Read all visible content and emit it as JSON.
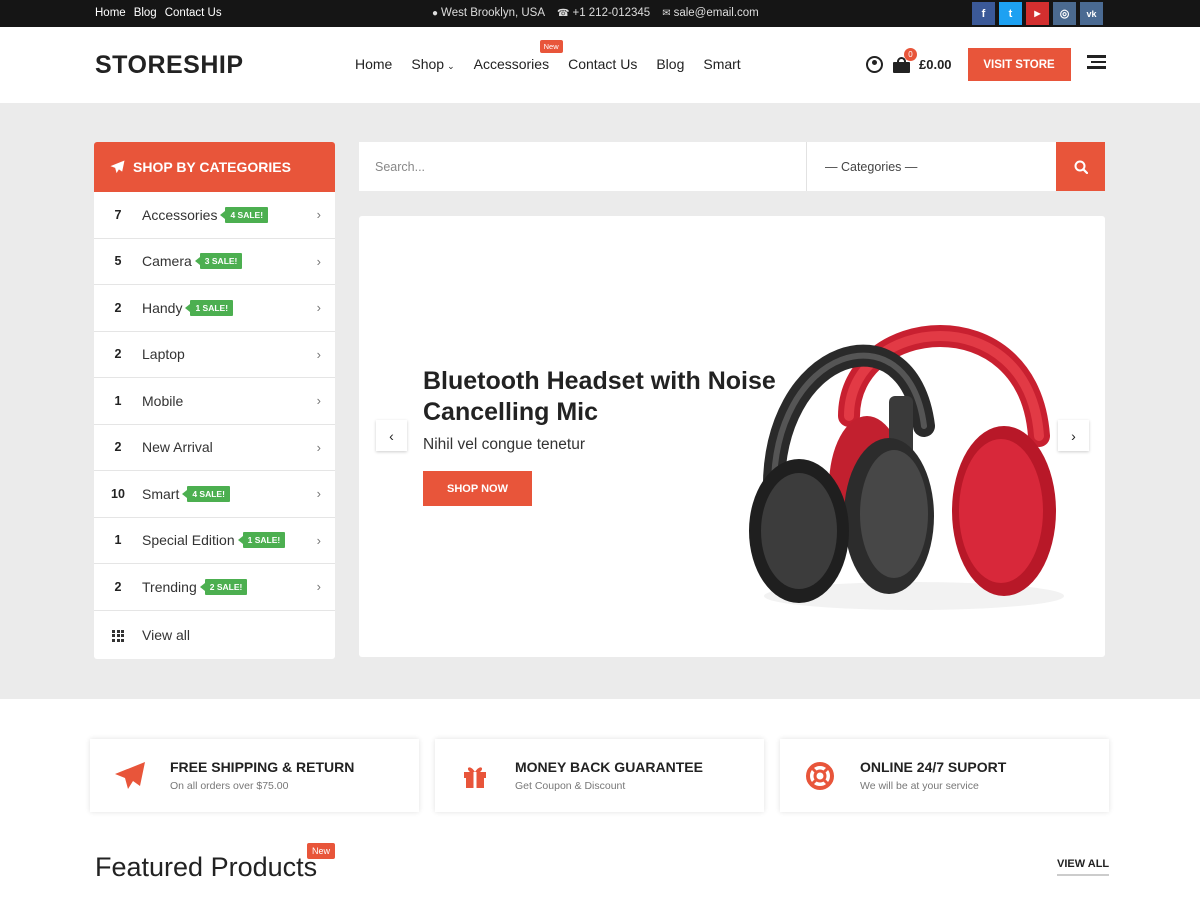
{
  "topbar": {
    "links": [
      "Home",
      "Blog",
      "Contact Us"
    ],
    "location": "West Brooklyn, USA",
    "phone": "+1 212-012345",
    "email": "sale@email.com",
    "socials": [
      {
        "icon": "facebook-icon",
        "glyph": "f",
        "color": "#3b5998"
      },
      {
        "icon": "twitter-icon",
        "glyph": "t",
        "color": "#1da1f2"
      },
      {
        "icon": "youtube-icon",
        "glyph": "▶",
        "color": "#d32f2f"
      },
      {
        "icon": "instagram-icon",
        "glyph": "◎",
        "color": "#4b6a8f"
      },
      {
        "icon": "vk-icon",
        "glyph": "vk",
        "color": "#4a6a92"
      }
    ]
  },
  "header": {
    "logo": "STORESHIP",
    "nav": {
      "home": "Home",
      "shop": "Shop",
      "accessories": "Accessories",
      "accessories_badge": "New",
      "contact": "Contact Us",
      "blog": "Blog",
      "smart": "Smart"
    },
    "cart_count": "0",
    "cart_total": "£0.00",
    "visit_store": "VISIT STORE"
  },
  "categories": {
    "title": "SHOP BY CATEGORIES",
    "items": [
      {
        "count": "7",
        "name": "Accessories",
        "sale": "4 SALE!"
      },
      {
        "count": "5",
        "name": "Camera",
        "sale": "3 SALE!"
      },
      {
        "count": "2",
        "name": "Handy",
        "sale": "1 SALE!"
      },
      {
        "count": "2",
        "name": "Laptop",
        "sale": ""
      },
      {
        "count": "1",
        "name": "Mobile",
        "sale": ""
      },
      {
        "count": "2",
        "name": "New Arrival",
        "sale": ""
      },
      {
        "count": "10",
        "name": "Smart",
        "sale": "4 SALE!"
      },
      {
        "count": "1",
        "name": "Special Edition",
        "sale": "1 SALE!"
      },
      {
        "count": "2",
        "name": "Trending",
        "sale": "2 SALE!"
      }
    ],
    "view_all": "View all"
  },
  "search": {
    "placeholder": "Search...",
    "category_select": "— Categories —"
  },
  "slider": {
    "title": "Bluetooth Headset with Noise Cancelling Mic",
    "subtitle": "Nihil vel congue tenetur",
    "button": "SHOP NOW"
  },
  "features": [
    {
      "icon": "paper-plane-icon",
      "title": "FREE SHIPPING & RETURN",
      "subtitle": "On all orders over $75.00"
    },
    {
      "icon": "gift-icon",
      "title": "MONEY BACK GUARANTEE",
      "subtitle": "Get Coupon & Discount"
    },
    {
      "icon": "life-ring-icon",
      "title": "ONLINE 24/7 SUPORT",
      "subtitle": "We will be at your service"
    }
  ],
  "featured": {
    "title": "Featured Products",
    "badge": "New",
    "view_all": "VIEW ALL"
  },
  "colors": {
    "accent": "#e8553a",
    "sale": "#4caf50",
    "topbar": "#151515"
  }
}
